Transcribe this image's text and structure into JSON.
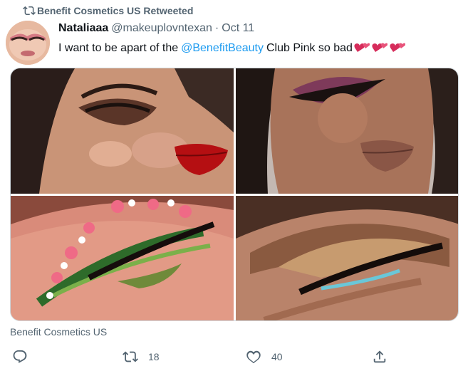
{
  "retweet": {
    "label": "Benefit Cosmetics US Retweeted",
    "icon": "retweet-icon"
  },
  "tweet": {
    "author_name": "Nataliaaa",
    "author_handle": "@makeuplovntexan",
    "separator": "·",
    "date": "Oct 11",
    "text_before": "I want to be apart of the",
    "mention": "@BenefitBeauty",
    "text_after": "Club Pink so bad",
    "emoji": "two-hearts-emoji"
  },
  "media": {
    "photos": [
      "makeup-photo-red-lips",
      "makeup-photo-winged-liner",
      "makeup-photo-floral-eye",
      "makeup-photo-bronze-eye"
    ]
  },
  "caption": "Benefit Cosmetics US",
  "actions": {
    "reply_count": "",
    "retweet_count": "18",
    "like_count": "40"
  },
  "colors": {
    "accent": "#1d9bf0",
    "secondary_text": "#536471",
    "border": "#cfd9de"
  }
}
